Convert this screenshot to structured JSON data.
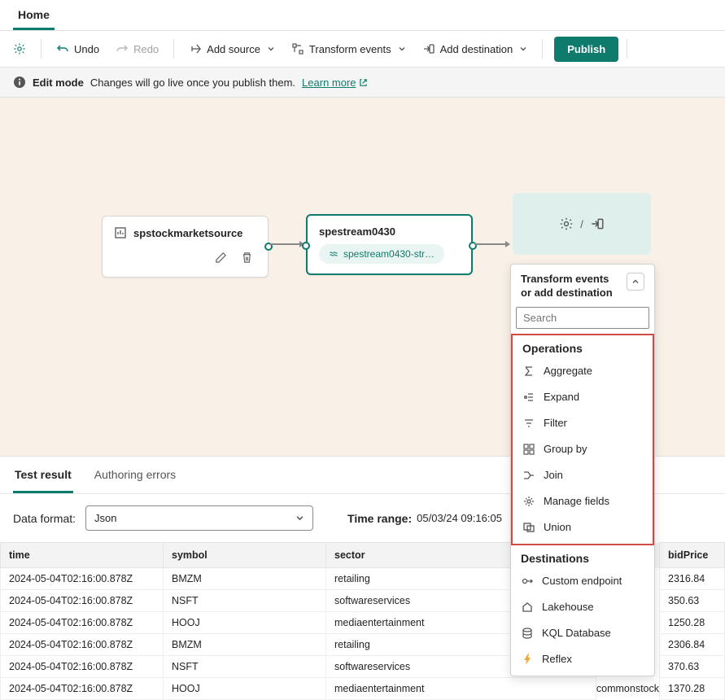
{
  "tab": {
    "home": "Home"
  },
  "toolbar": {
    "undo": "Undo",
    "redo": "Redo",
    "add_source": "Add source",
    "transform_events": "Transform events",
    "add_destination": "Add destination",
    "publish": "Publish"
  },
  "edit_bar": {
    "mode": "Edit mode",
    "msg": "Changes will go live once you publish them.",
    "learn_more": "Learn more"
  },
  "canvas": {
    "source_node": {
      "title": "spstockmarketsource"
    },
    "stream_node": {
      "title": "spestream0430",
      "pill": "spestream0430-str…"
    }
  },
  "popup": {
    "title": "Transform events or add destination",
    "search_placeholder": "Search",
    "operations_title": "Operations",
    "operations": [
      "Aggregate",
      "Expand",
      "Filter",
      "Group by",
      "Join",
      "Manage fields",
      "Union"
    ],
    "destinations_title": "Destinations",
    "destinations": [
      "Custom endpoint",
      "Lakehouse",
      "KQL Database",
      "Reflex"
    ]
  },
  "bottom": {
    "tabs": {
      "test_result": "Test result",
      "authoring_errors": "Authoring errors"
    },
    "data_format_label": "Data format:",
    "data_format_value": "Json",
    "time_range_label": "Time range:",
    "time_range_value": "05/03/24 09:16:05",
    "columns": [
      "time",
      "symbol",
      "sector",
      "",
      "bidPrice"
    ],
    "rows": [
      {
        "time": "2024-05-04T02:16:00.878Z",
        "symbol": "BMZM",
        "sector": "retailing",
        "c4": "",
        "bid": "2316.84"
      },
      {
        "time": "2024-05-04T02:16:00.878Z",
        "symbol": "NSFT",
        "sector": "softwareservices",
        "c4": "",
        "bid": "350.63"
      },
      {
        "time": "2024-05-04T02:16:00.878Z",
        "symbol": "HOOJ",
        "sector": "mediaentertainment",
        "c4": "",
        "bid": "1250.28"
      },
      {
        "time": "2024-05-04T02:16:00.878Z",
        "symbol": "BMZM",
        "sector": "retailing",
        "c4": "",
        "bid": "2306.84"
      },
      {
        "time": "2024-05-04T02:16:00.878Z",
        "symbol": "NSFT",
        "sector": "softwareservices",
        "c4": "",
        "bid": "370.63"
      },
      {
        "time": "2024-05-04T02:16:00.878Z",
        "symbol": "HOOJ",
        "sector": "mediaentertainment",
        "c4": "commonstock",
        "bid": "1370.28"
      }
    ]
  }
}
